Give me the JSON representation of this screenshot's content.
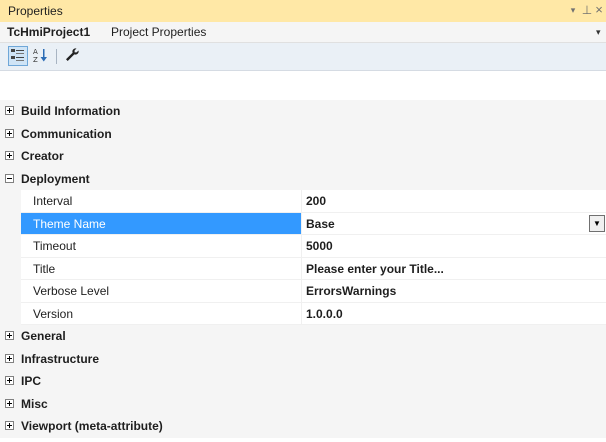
{
  "window": {
    "title": "Properties"
  },
  "title_buttons": {
    "dropdown": "▾",
    "pin": "⊥",
    "close": "×"
  },
  "object": {
    "name": "TcHmiProject1",
    "type": "Project Properties",
    "dropdown": "▾"
  },
  "icons": {
    "categorized": "categorized-icon",
    "alphabetical": "sort-alphabetical-icon",
    "property_pages": "wrench-icon"
  },
  "colors": {
    "titlebar": "#ffe8a6",
    "selected": "#3399ff",
    "category_bg": "#f5f5f5"
  },
  "rows": [
    {
      "kind": "category",
      "label": "Build Information",
      "expanded": false
    },
    {
      "kind": "category",
      "label": "Communication",
      "expanded": false
    },
    {
      "kind": "category",
      "label": "Creator",
      "expanded": false
    },
    {
      "kind": "category",
      "label": "Deployment",
      "expanded": true
    },
    {
      "kind": "property",
      "name": "Interval",
      "value": "200"
    },
    {
      "kind": "property",
      "name": "Theme Name",
      "value": "Base",
      "selected": true,
      "combo": true,
      "combo_glyph": "▼"
    },
    {
      "kind": "property",
      "name": "Timeout",
      "value": "5000"
    },
    {
      "kind": "property",
      "name": "Title",
      "value": "Please enter your Title..."
    },
    {
      "kind": "property",
      "name": "Verbose Level",
      "value": "ErrorsWarnings"
    },
    {
      "kind": "property",
      "name": "Version",
      "value": "1.0.0.0"
    },
    {
      "kind": "category",
      "label": "General",
      "expanded": false
    },
    {
      "kind": "category",
      "label": "Infrastructure",
      "expanded": false
    },
    {
      "kind": "category",
      "label": "IPC",
      "expanded": false
    },
    {
      "kind": "category",
      "label": "Misc",
      "expanded": false
    },
    {
      "kind": "category",
      "label": "Viewport (meta-attribute)",
      "expanded": false
    }
  ]
}
